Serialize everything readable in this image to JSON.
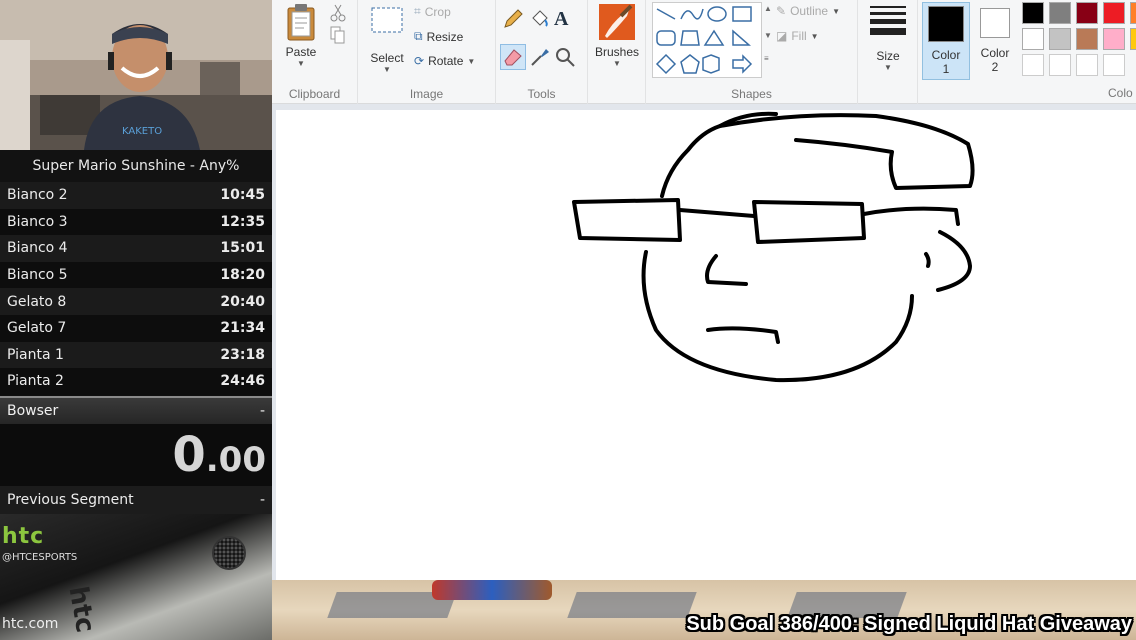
{
  "livesplit": {
    "game_title": "Super Mario Sunshine - Any%",
    "splits": [
      {
        "name": "Bianco 2",
        "time": "10:45"
      },
      {
        "name": "Bianco 3",
        "time": "12:35"
      },
      {
        "name": "Bianco 4",
        "time": "15:01"
      },
      {
        "name": "Bianco 5",
        "time": "18:20"
      },
      {
        "name": "Gelato 8",
        "time": "20:40"
      },
      {
        "name": "Gelato 7",
        "time": "21:34"
      },
      {
        "name": "Pianta 1",
        "time": "23:18"
      },
      {
        "name": "Pianta 2",
        "time": "24:46"
      }
    ],
    "current_split": {
      "name": "Bowser",
      "time": "-"
    },
    "timer": {
      "main": "0",
      "fraction": ".00"
    },
    "previous_segment": {
      "label": "Previous Segment",
      "value": "-"
    }
  },
  "sponsor": {
    "logo": "htc",
    "handle": "@HTCESPORTS",
    "url": "htc.com",
    "phone_text": "htc"
  },
  "paint": {
    "groups": {
      "clipboard": "Clipboard",
      "image": "Image",
      "tools": "Tools",
      "shapes": "Shapes",
      "colors": "Colo"
    },
    "buttons": {
      "paste": "Paste",
      "select": "Select",
      "crop": "Crop",
      "resize": "Resize",
      "rotate": "Rotate",
      "brushes": "Brushes",
      "outline": "Outline",
      "fill": "Fill",
      "size": "Size",
      "color1": "Color",
      "color1_num": "1",
      "color2": "Color",
      "color2_num": "2"
    },
    "palette": [
      "#000000",
      "#7f7f7f",
      "#880015",
      "#ed1c24",
      "#ff7f27",
      "#ffffff",
      "#c3c3c3",
      "#b97a57",
      "#ffaec9",
      "#ffc90e"
    ],
    "color1_value": "#000000",
    "color2_value": "#ffffff"
  },
  "overlay": {
    "sub_goal": "Sub Goal 386/400: Signed Liquid Hat Giveaway"
  }
}
